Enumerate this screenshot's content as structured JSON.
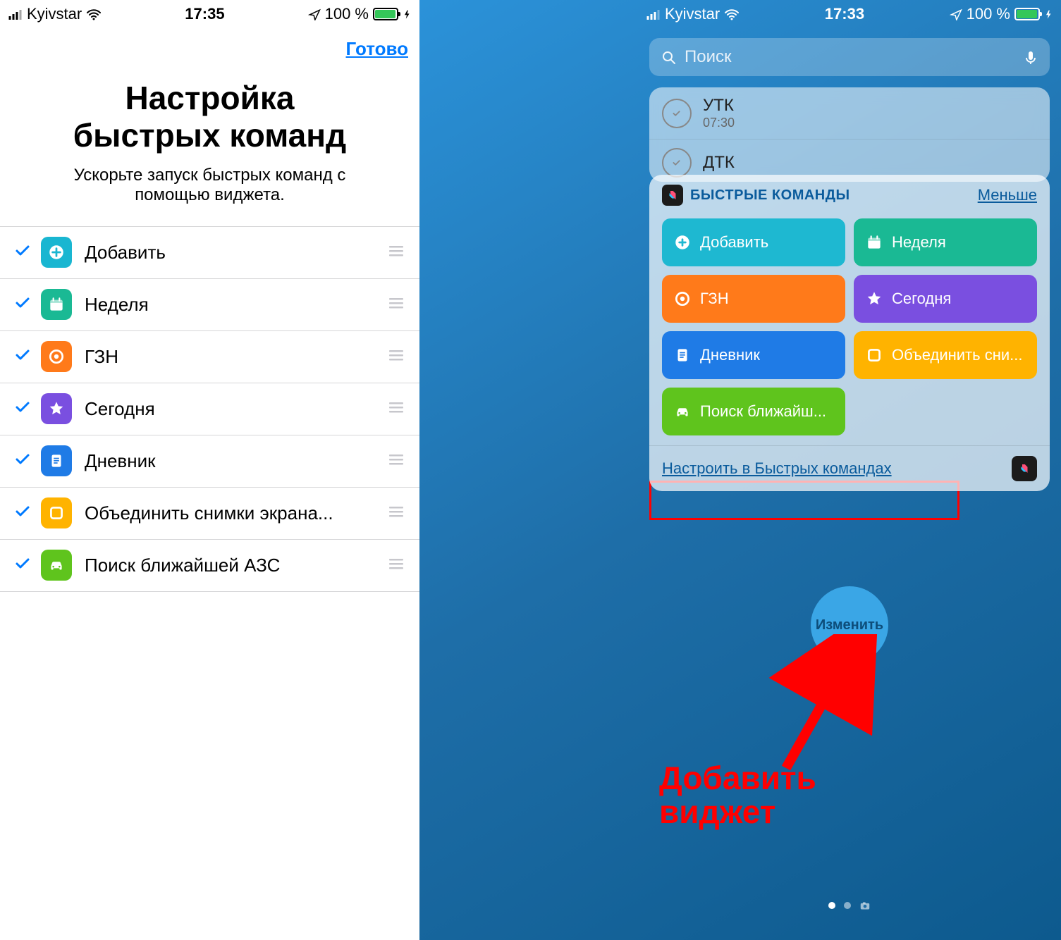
{
  "left": {
    "status": {
      "carrier": "Kyivstar",
      "time": "17:35",
      "battery": "100 %"
    },
    "done": "Готово",
    "title1": "Настройка",
    "title2": "быстрых команд",
    "subtitle": "Ускорьте запуск быстрых команд с помощью виджета.",
    "items": [
      {
        "label": "Добавить",
        "color": "#19b6d1",
        "icon": "plus"
      },
      {
        "label": "Неделя",
        "color": "#1ab994",
        "icon": "calendar"
      },
      {
        "label": "ГЗН",
        "color": "#ff7a1a",
        "icon": "target"
      },
      {
        "label": "Сегодня",
        "color": "#7a4fe0",
        "icon": "star"
      },
      {
        "label": "Дневник",
        "color": "#1f7be6",
        "icon": "doc"
      },
      {
        "label": "Объединить снимки экрана...",
        "color": "#ffb300",
        "icon": "square"
      },
      {
        "label": "Поиск ближайшей АЗС",
        "color": "#5fc41d",
        "icon": "car"
      }
    ]
  },
  "right": {
    "status": {
      "carrier": "Kyivstar",
      "time": "17:33",
      "battery": "100 %"
    },
    "search_placeholder": "Поиск",
    "alarms": [
      {
        "name": "УТК",
        "time": "07:30"
      },
      {
        "name": "ДТК",
        "time": ""
      }
    ],
    "widget": {
      "title": "БЫСТРЫЕ КОМАНДЫ",
      "less": "Меньше",
      "tiles": [
        {
          "label": "Добавить",
          "color": "#1eb8d1",
          "icon": "plus-circle"
        },
        {
          "label": "Неделя",
          "color": "#1ab994",
          "icon": "calendar"
        },
        {
          "label": "ГЗН",
          "color": "#ff7a1a",
          "icon": "target"
        },
        {
          "label": "Сегодня",
          "color": "#7a4fe0",
          "icon": "star"
        },
        {
          "label": "Дневник",
          "color": "#1f7be6",
          "icon": "doc"
        },
        {
          "label": "Объединить сни...",
          "color": "#ffb300",
          "icon": "square"
        },
        {
          "label": "Поиск ближайш...",
          "color": "#5fc41d",
          "icon": "car"
        }
      ],
      "configure": "Настроить в Быстрых командах"
    },
    "edit_button": "Изменить",
    "annotation": "Добавить\nвиджет"
  }
}
